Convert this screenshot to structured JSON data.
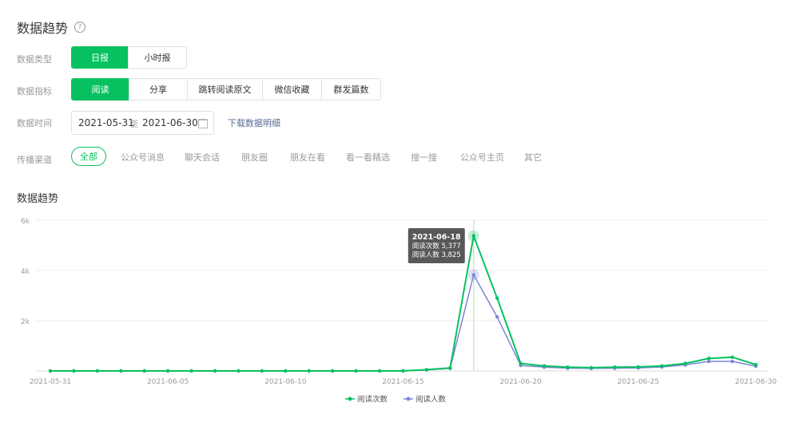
{
  "page": {
    "title": "数据趋势",
    "help_icon": "?"
  },
  "filters": {
    "data_type": {
      "label": "数据类型",
      "options": [
        "日报",
        "小时报"
      ],
      "selected": "日报"
    },
    "data_metric": {
      "label": "数据指标",
      "options": [
        "阅读",
        "分享",
        "跳转阅读原文",
        "微信收藏",
        "群发篇数"
      ],
      "selected": "阅读"
    },
    "data_time": {
      "label": "数据时间",
      "start": "2021-05-31",
      "separator": "至",
      "end": "2021-06-30",
      "download_label": "下载数据明细"
    },
    "channel": {
      "label": "传播渠道",
      "selected": "全部",
      "options": [
        "全部",
        "公众号消息",
        "聊天会话",
        "朋友圈",
        "朋友在看",
        "看一看精选",
        "搜一搜",
        "公众号主页",
        "其它"
      ]
    }
  },
  "chart_section": {
    "title": "数据趋势"
  },
  "tooltip": {
    "date": "2021-06-18",
    "line1": "阅读次数 5,377",
    "line2": "阅读人数 3,825"
  },
  "colors": {
    "brand_green": "#07c160",
    "series_blue": "#7b86d8",
    "link": "#576b95"
  },
  "chart_data": {
    "type": "line",
    "x": [
      "2021-05-31",
      "2021-06-01",
      "2021-06-02",
      "2021-06-03",
      "2021-06-04",
      "2021-06-05",
      "2021-06-06",
      "2021-06-07",
      "2021-06-08",
      "2021-06-09",
      "2021-06-10",
      "2021-06-11",
      "2021-06-12",
      "2021-06-13",
      "2021-06-14",
      "2021-06-15",
      "2021-06-16",
      "2021-06-17",
      "2021-06-18",
      "2021-06-19",
      "2021-06-20",
      "2021-06-21",
      "2021-06-22",
      "2021-06-23",
      "2021-06-24",
      "2021-06-25",
      "2021-06-26",
      "2021-06-27",
      "2021-06-28",
      "2021-06-29",
      "2021-06-30"
    ],
    "x_tick_labels": [
      "2021-05-31",
      "2021-06-05",
      "2021-06-10",
      "2021-06-15",
      "2021-06-20",
      "2021-06-25",
      "2021-06-30"
    ],
    "y_ticks": [
      0,
      2000,
      4000,
      6000
    ],
    "y_tick_labels": [
      "",
      "2k",
      "4k",
      "6k"
    ],
    "ylim": [
      0,
      6000
    ],
    "grid": true,
    "legend_position": "bottom",
    "highlight_x": "2021-06-18",
    "series": [
      {
        "name": "阅读次数",
        "color": "#07c160",
        "values": [
          0,
          0,
          0,
          0,
          0,
          0,
          0,
          0,
          0,
          0,
          0,
          0,
          0,
          0,
          0,
          0,
          50,
          120,
          5377,
          2900,
          300,
          200,
          150,
          130,
          150,
          160,
          200,
          300,
          500,
          550,
          250
        ]
      },
      {
        "name": "阅读人数",
        "color": "#7b86d8",
        "values": [
          0,
          0,
          0,
          0,
          0,
          0,
          0,
          0,
          0,
          0,
          0,
          0,
          0,
          0,
          0,
          0,
          40,
          100,
          3825,
          2150,
          220,
          150,
          110,
          100,
          110,
          120,
          160,
          240,
          380,
          380,
          190
        ]
      }
    ]
  }
}
